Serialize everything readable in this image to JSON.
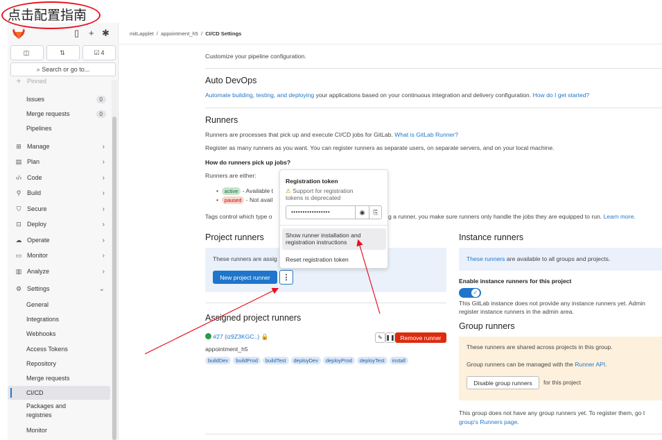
{
  "annotation": {
    "label": "点击配置指南"
  },
  "sidebar": {
    "count_issues": "",
    "count_mr": "",
    "count_todo": "4",
    "search": "Search or go to...",
    "pinned": "Pinned",
    "items": [
      {
        "label": "Issues",
        "badge": "0"
      },
      {
        "label": "Merge requests",
        "badge": "0"
      },
      {
        "label": "Pipelines"
      },
      {
        "label": "Manage"
      },
      {
        "label": "Plan"
      },
      {
        "label": "Code"
      },
      {
        "label": "Build"
      },
      {
        "label": "Secure"
      },
      {
        "label": "Deploy"
      },
      {
        "label": "Operate"
      },
      {
        "label": "Monitor"
      },
      {
        "label": "Analyze"
      },
      {
        "label": "Settings"
      },
      {
        "label": "General"
      },
      {
        "label": "Integrations"
      },
      {
        "label": "Webhooks"
      },
      {
        "label": "Access Tokens"
      },
      {
        "label": "Repository"
      },
      {
        "label": "Merge requests"
      },
      {
        "label": "CI/CD"
      },
      {
        "label": "Packages and"
      },
      {
        "label": "registries"
      },
      {
        "label": "Monitor"
      }
    ]
  },
  "breadcrumb": {
    "a": "mitLapplet",
    "b": "appointment_h5",
    "c": "CI/CD Settings"
  },
  "general": {
    "desc": "Customize your pipeline configuration."
  },
  "autodevops": {
    "title": "Auto DevOps",
    "link1": "Automate building, testing, and deploying",
    "text1": " your applications based on your continuous integration and delivery configuration. ",
    "link2": "How do I get started?"
  },
  "runners": {
    "title": "Runners",
    "desc1": "Runners are processes that pick up and execute CI/CD jobs for GitLab. ",
    "desc1_link": "What is GitLab Runner?",
    "desc2": "Register as many runners as you want. You can register runners as separate users, on separate servers, and on your local machine.",
    "howto": "How do runners pick up jobs?",
    "either": "Runners are either:",
    "active": "active",
    "active_text": " - Available t",
    "paused": "paused",
    "paused_text": " - Not avail",
    "tags_a": "Tags control which type o",
    "tags_b": "g a runner, you make sure runners only handle the jobs they are equipped to run. ",
    "tags_link": "Learn more."
  },
  "project_runners": {
    "title": "Project runners",
    "panel_text": "These runners are assig",
    "new_button": "New project runner",
    "kebab": "⋮"
  },
  "popover": {
    "title": "Registration token",
    "warn1": "Support for registration",
    "warn2": "tokens is deprecated",
    "token": "•••••••••••••••••",
    "item1a": "Show runner installation and",
    "item1b": "registration instructions",
    "item2": "Reset registration token"
  },
  "assigned": {
    "title": "Assigned project runners",
    "runner_id": "#27 (iz9Z3KGC..)",
    "runner_desc": "appointment_h5",
    "remove": "Remove runner",
    "tags": [
      "buildDev",
      "buildProd",
      "buildTest",
      "deployDev",
      "deployProd",
      "deployTest",
      "install"
    ]
  },
  "instance": {
    "title": "Instance runners",
    "panel_link": "These runners",
    "panel_text": " are available to all groups and projects.",
    "enable_label": "Enable instance runners for this project",
    "note1": "This GitLab instance does not provide any instance runners yet. Admin",
    "note2": "register instance runners in the admin area."
  },
  "group": {
    "title": "Group runners",
    "text1": "These runners are shared across projects in this group.",
    "text2": "Group runners can be managed with the ",
    "text2_link": "Runner API",
    "text2_end": ".",
    "disable_button": "Disable group runners",
    "for_project": "for this project",
    "footer1": "This group does not have any group runners yet. To register them, go t",
    "footer2": "group's Runners page",
    "footer2_end": "."
  },
  "colors": {
    "accent": "#1f75cb",
    "danger": "#dd2b0e",
    "annotation": "#e8101f"
  }
}
